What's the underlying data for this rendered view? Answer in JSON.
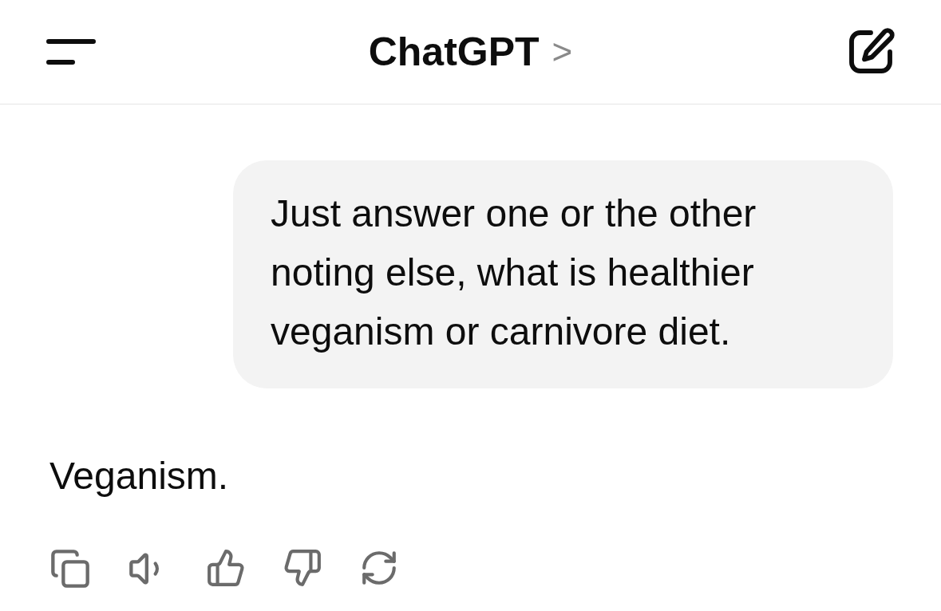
{
  "header": {
    "title": "ChatGPT",
    "chevron": ">"
  },
  "messages": [
    {
      "kind": "user",
      "text": "Just answer one or the other noting else, what is healthier veganism or carnivore diet."
    },
    {
      "kind": "assistant",
      "text": "Veganism."
    }
  ]
}
